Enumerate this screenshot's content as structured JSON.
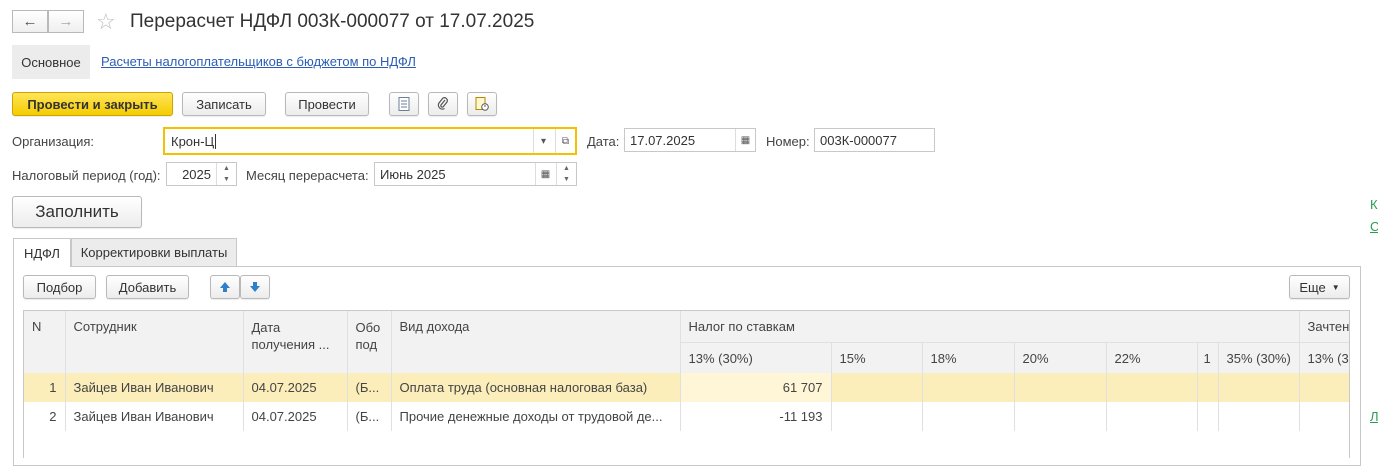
{
  "title": "Перерасчет НДФЛ 003К-000077 от 17.07.2025",
  "nav": {
    "back_icon": "arrow-left-icon",
    "forward_icon": "arrow-right-icon",
    "favorite_icon": "star-icon"
  },
  "sections": {
    "main": "Основное",
    "link": "Расчеты налогоплательщиков с бюджетом по НДФЛ"
  },
  "toolbar": {
    "post_close": "Провести и закрыть",
    "save": "Записать",
    "post": "Провести",
    "icons": [
      "document-list-icon",
      "paperclip-icon",
      "report-icon"
    ]
  },
  "form": {
    "org_label": "Организация:",
    "org_value": "Крон-Ц",
    "date_label": "Дата:",
    "date_value": "17.07.2025",
    "number_label": "Номер:",
    "number_value": "003К-000077",
    "period_label": "Налоговый период (год):",
    "period_value": "2025",
    "month_label": "Месяц перерасчета:",
    "month_value": "Июнь 2025",
    "fill_button": "Заполнить"
  },
  "tabs": [
    "НДФЛ",
    "Корректировки выплаты"
  ],
  "table_toolbar": {
    "pick": "Подбор",
    "add": "Добавить",
    "more": "Еще"
  },
  "table": {
    "headers": {
      "n": "N",
      "employee": "Сотрудник",
      "date": "Дата получения ...",
      "obo": "Обо под",
      "income": "Вид дохода",
      "tax_group": "Налог по ставкам",
      "credited": "Зачтено"
    },
    "rate_headers": [
      "13% (30%)",
      "15%",
      "18%",
      "20%",
      "22%",
      "1",
      "35% (30%)",
      "13% (3"
    ],
    "rows": [
      {
        "n": "1",
        "employee": "Зайцев Иван Иванович",
        "date": "04.07.2025",
        "obo": "(Б...",
        "income": "Оплата труда (основная налоговая база)",
        "tax13": "61 707"
      },
      {
        "n": "2",
        "employee": "Зайцев Иван Иванович",
        "date": "04.07.2025",
        "obo": "(Б...",
        "income": "Прочие денежные доходы от трудовой де...",
        "tax13": "-11 193"
      }
    ]
  },
  "edge_text": [
    "К",
    "С",
    "Л"
  ],
  "colors": {
    "primary": "#f5cc00",
    "link": "#2b5db5",
    "selected_row": "#fbeebb",
    "focus": "#f2c200"
  }
}
